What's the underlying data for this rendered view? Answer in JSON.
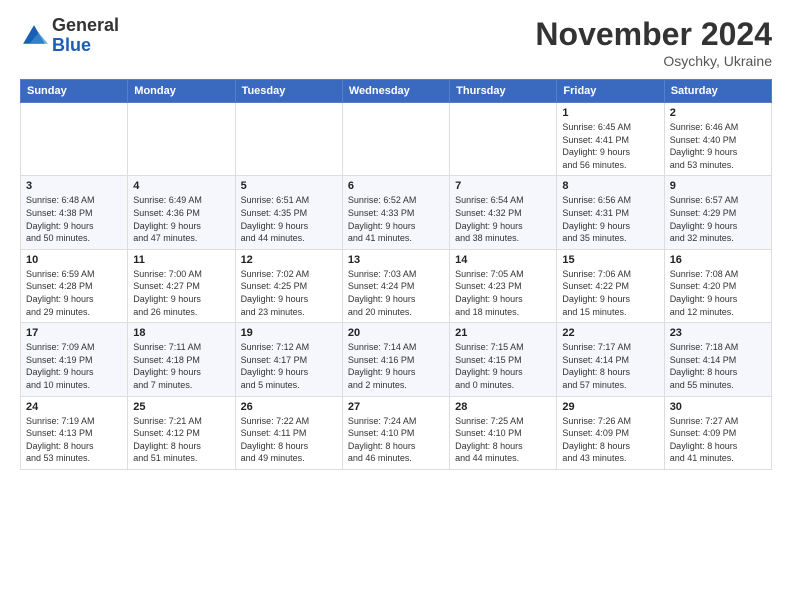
{
  "logo": {
    "general": "General",
    "blue": "Blue"
  },
  "header": {
    "month": "November 2024",
    "location": "Osychky, Ukraine"
  },
  "weekdays": [
    "Sunday",
    "Monday",
    "Tuesday",
    "Wednesday",
    "Thursday",
    "Friday",
    "Saturday"
  ],
  "weeks": [
    [
      {
        "day": "",
        "info": ""
      },
      {
        "day": "",
        "info": ""
      },
      {
        "day": "",
        "info": ""
      },
      {
        "day": "",
        "info": ""
      },
      {
        "day": "",
        "info": ""
      },
      {
        "day": "1",
        "info": "Sunrise: 6:45 AM\nSunset: 4:41 PM\nDaylight: 9 hours\nand 56 minutes."
      },
      {
        "day": "2",
        "info": "Sunrise: 6:46 AM\nSunset: 4:40 PM\nDaylight: 9 hours\nand 53 minutes."
      }
    ],
    [
      {
        "day": "3",
        "info": "Sunrise: 6:48 AM\nSunset: 4:38 PM\nDaylight: 9 hours\nand 50 minutes."
      },
      {
        "day": "4",
        "info": "Sunrise: 6:49 AM\nSunset: 4:36 PM\nDaylight: 9 hours\nand 47 minutes."
      },
      {
        "day": "5",
        "info": "Sunrise: 6:51 AM\nSunset: 4:35 PM\nDaylight: 9 hours\nand 44 minutes."
      },
      {
        "day": "6",
        "info": "Sunrise: 6:52 AM\nSunset: 4:33 PM\nDaylight: 9 hours\nand 41 minutes."
      },
      {
        "day": "7",
        "info": "Sunrise: 6:54 AM\nSunset: 4:32 PM\nDaylight: 9 hours\nand 38 minutes."
      },
      {
        "day": "8",
        "info": "Sunrise: 6:56 AM\nSunset: 4:31 PM\nDaylight: 9 hours\nand 35 minutes."
      },
      {
        "day": "9",
        "info": "Sunrise: 6:57 AM\nSunset: 4:29 PM\nDaylight: 9 hours\nand 32 minutes."
      }
    ],
    [
      {
        "day": "10",
        "info": "Sunrise: 6:59 AM\nSunset: 4:28 PM\nDaylight: 9 hours\nand 29 minutes."
      },
      {
        "day": "11",
        "info": "Sunrise: 7:00 AM\nSunset: 4:27 PM\nDaylight: 9 hours\nand 26 minutes."
      },
      {
        "day": "12",
        "info": "Sunrise: 7:02 AM\nSunset: 4:25 PM\nDaylight: 9 hours\nand 23 minutes."
      },
      {
        "day": "13",
        "info": "Sunrise: 7:03 AM\nSunset: 4:24 PM\nDaylight: 9 hours\nand 20 minutes."
      },
      {
        "day": "14",
        "info": "Sunrise: 7:05 AM\nSunset: 4:23 PM\nDaylight: 9 hours\nand 18 minutes."
      },
      {
        "day": "15",
        "info": "Sunrise: 7:06 AM\nSunset: 4:22 PM\nDaylight: 9 hours\nand 15 minutes."
      },
      {
        "day": "16",
        "info": "Sunrise: 7:08 AM\nSunset: 4:20 PM\nDaylight: 9 hours\nand 12 minutes."
      }
    ],
    [
      {
        "day": "17",
        "info": "Sunrise: 7:09 AM\nSunset: 4:19 PM\nDaylight: 9 hours\nand 10 minutes."
      },
      {
        "day": "18",
        "info": "Sunrise: 7:11 AM\nSunset: 4:18 PM\nDaylight: 9 hours\nand 7 minutes."
      },
      {
        "day": "19",
        "info": "Sunrise: 7:12 AM\nSunset: 4:17 PM\nDaylight: 9 hours\nand 5 minutes."
      },
      {
        "day": "20",
        "info": "Sunrise: 7:14 AM\nSunset: 4:16 PM\nDaylight: 9 hours\nand 2 minutes."
      },
      {
        "day": "21",
        "info": "Sunrise: 7:15 AM\nSunset: 4:15 PM\nDaylight: 9 hours\nand 0 minutes."
      },
      {
        "day": "22",
        "info": "Sunrise: 7:17 AM\nSunset: 4:14 PM\nDaylight: 8 hours\nand 57 minutes."
      },
      {
        "day": "23",
        "info": "Sunrise: 7:18 AM\nSunset: 4:14 PM\nDaylight: 8 hours\nand 55 minutes."
      }
    ],
    [
      {
        "day": "24",
        "info": "Sunrise: 7:19 AM\nSunset: 4:13 PM\nDaylight: 8 hours\nand 53 minutes."
      },
      {
        "day": "25",
        "info": "Sunrise: 7:21 AM\nSunset: 4:12 PM\nDaylight: 8 hours\nand 51 minutes."
      },
      {
        "day": "26",
        "info": "Sunrise: 7:22 AM\nSunset: 4:11 PM\nDaylight: 8 hours\nand 49 minutes."
      },
      {
        "day": "27",
        "info": "Sunrise: 7:24 AM\nSunset: 4:10 PM\nDaylight: 8 hours\nand 46 minutes."
      },
      {
        "day": "28",
        "info": "Sunrise: 7:25 AM\nSunset: 4:10 PM\nDaylight: 8 hours\nand 44 minutes."
      },
      {
        "day": "29",
        "info": "Sunrise: 7:26 AM\nSunset: 4:09 PM\nDaylight: 8 hours\nand 43 minutes."
      },
      {
        "day": "30",
        "info": "Sunrise: 7:27 AM\nSunset: 4:09 PM\nDaylight: 8 hours\nand 41 minutes."
      }
    ]
  ]
}
